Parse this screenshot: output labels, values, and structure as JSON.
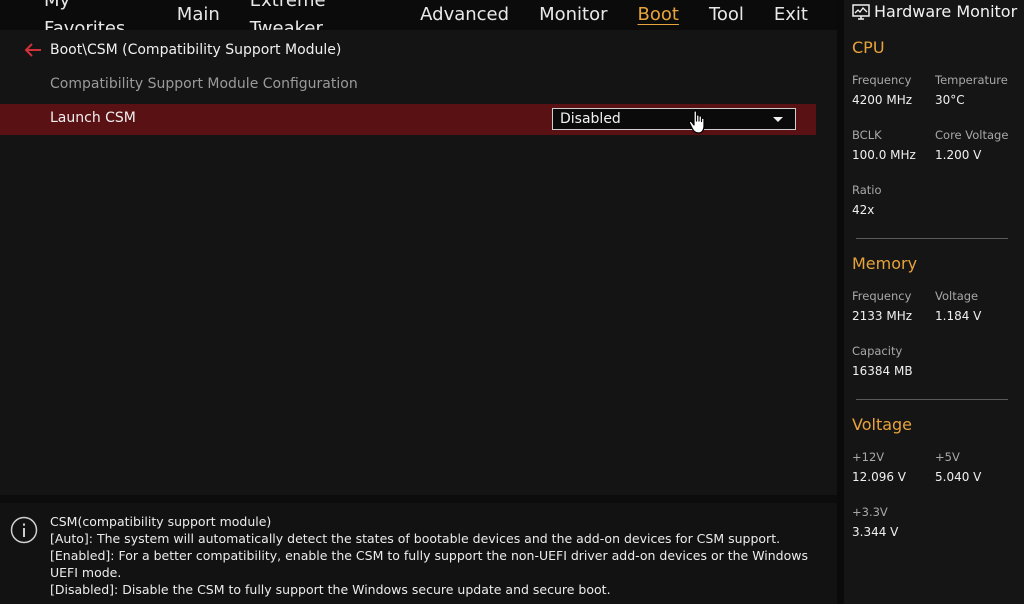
{
  "nav": {
    "tabs": [
      "My Favorites",
      "Main",
      "Extreme Tweaker",
      "Advanced",
      "Monitor",
      "Boot",
      "Tool",
      "Exit"
    ],
    "active": "Boot"
  },
  "page": {
    "breadcrumb": "Boot\\CSM (Compatibility Support Module)",
    "subtitle": "Compatibility Support Module Configuration",
    "setting": {
      "label": "Launch CSM",
      "value": "Disabled"
    }
  },
  "help": {
    "lines": [
      "CSM(compatibility support module)",
      "[Auto]: The system will automatically detect the states of bootable devices and the add-on devices for CSM support.",
      "[Enabled]: For a better compatibility, enable the CSM to fully support the non-UEFI driver add-on devices or the Windows UEFI mode.",
      "[Disabled]: Disable the CSM to fully support the Windows secure update and secure boot."
    ]
  },
  "monitor": {
    "title": "Hardware Monitor",
    "cpu": {
      "heading": "CPU",
      "frequency_label": "Frequency",
      "frequency": "4200 MHz",
      "temperature_label": "Temperature",
      "temperature": "30°C",
      "bclk_label": "BCLK",
      "bclk": "100.0 MHz",
      "core_voltage_label": "Core Voltage",
      "core_voltage": "1.200 V",
      "ratio_label": "Ratio",
      "ratio": "42x"
    },
    "memory": {
      "heading": "Memory",
      "frequency_label": "Frequency",
      "frequency": "2133 MHz",
      "voltage_label": "Voltage",
      "voltage": "1.184 V",
      "capacity_label": "Capacity",
      "capacity": "16384 MB"
    },
    "voltage": {
      "heading": "Voltage",
      "v12_label": "+12V",
      "v12": "12.096 V",
      "v5_label": "+5V",
      "v5": "5.040 V",
      "v33_label": "+3.3V",
      "v33": "3.344 V"
    }
  },
  "colors": {
    "accent": "#e8a33a",
    "highlight_row": "#5a1114",
    "back_arrow": "#d0303a"
  }
}
